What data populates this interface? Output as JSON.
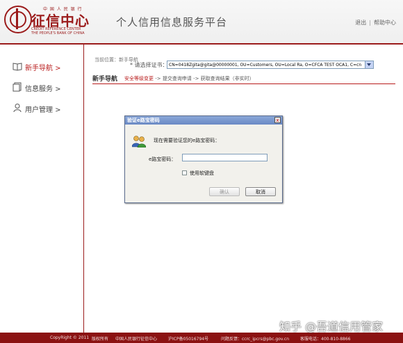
{
  "header": {
    "logo_top": "中 国 人 民 银 行",
    "logo_name": "征信中心",
    "logo_en_line1": "CREDIT REFERENCE CENTER",
    "logo_en_line2": "THE PEOPLE'S BANK OF CHINA",
    "site_title": "个人信用信息服务平台",
    "logout_label": "退出",
    "help_label": "帮助中心",
    "separator": "|"
  },
  "sidebar": {
    "items": [
      {
        "label": "新手导航 >",
        "icon": "book-icon",
        "active": true
      },
      {
        "label": "信息服务 >",
        "icon": "document-icon",
        "active": false
      },
      {
        "label": "用户管理 >",
        "icon": "user-icon",
        "active": false
      }
    ]
  },
  "main": {
    "breadcrumb": "当前位置：新手导航",
    "section_title": "新手导航",
    "steps": {
      "current": "安全等级变更",
      "rest": " -> 提交查询申请 -> 获取查询结果（非实时）"
    },
    "cert_label": "* 请选择证书：",
    "cert_value": "CN=0418Zgita@gita@00000001, OU=Customers, OU=Local Ra, O=CFCA TEST OCA1, C=cn"
  },
  "dialog": {
    "title": "验证e路宝密码",
    "close_label": "x",
    "message": "现在需要验证您的e路宝密码：",
    "password_label": "e路宝密码：",
    "password_value": "",
    "soft_keyboard_label": "使用软键盘",
    "soft_keyboard_checked": false,
    "ok_label": "确认",
    "cancel_label": "取消"
  },
  "footer": {
    "copyright": "CopyRight © 2011",
    "rights": "版权所有",
    "org": "中国人民银行征信中心",
    "icp": "沪ICP备05016794号",
    "feedback": "问题反馈：ccrc_ipcrs@pbc.gov.cn",
    "hotline": "客服电话：400-810-8866"
  },
  "watermark": {
    "text": "知乎 @吾道信用管家"
  },
  "colors": {
    "brand_red": "#9b1b1b",
    "footer_red": "#8b1212",
    "dialog_titlebar": "#7a98cf"
  }
}
